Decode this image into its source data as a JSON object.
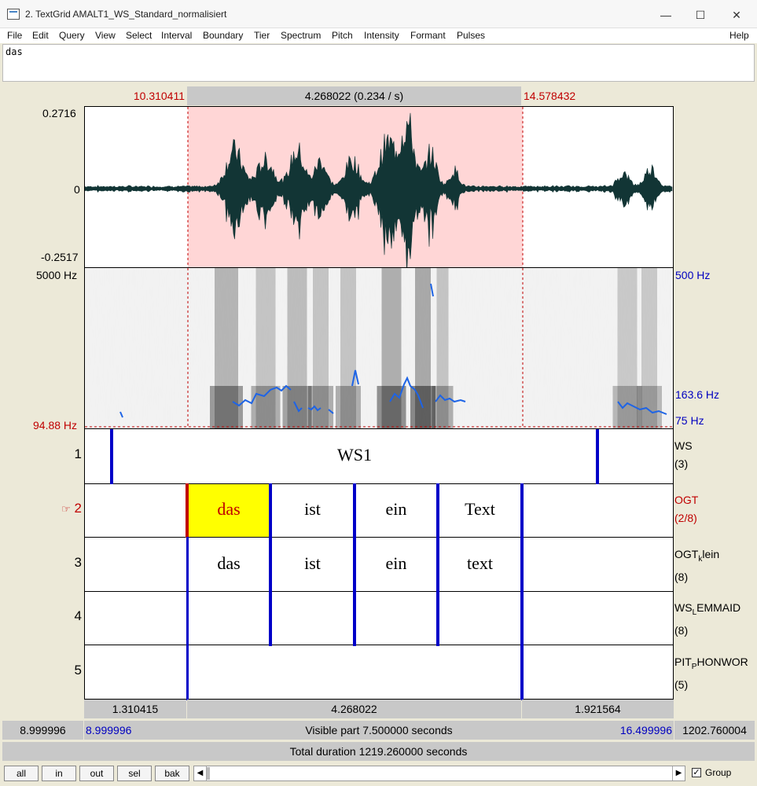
{
  "window": {
    "title": "2. TextGrid AMALT1_WS_Standard_normalisiert",
    "minimize": "—",
    "maximize": "☐",
    "close": "✕"
  },
  "menu": [
    "File",
    "Edit",
    "Query",
    "View",
    "Select",
    "Interval",
    "Boundary",
    "Tier",
    "Spectrum",
    "Pitch",
    "Intensity",
    "Formant",
    "Pulses"
  ],
  "menu_help": "Help",
  "text_field": {
    "value": "das"
  },
  "selection": {
    "start": "10.310411",
    "duration": "4.268022 (0.234 / s)",
    "end": "14.578432"
  },
  "waveform": {
    "max": "0.2716",
    "zero": "0",
    "min": "-0.2517"
  },
  "spectrogram": {
    "freq_max": "5000 Hz",
    "freq_min": "94.88 Hz",
    "pitch_max": "500 Hz",
    "pitch_cursor": "163.6 Hz",
    "pitch_min": "75 Hz"
  },
  "tiers": [
    {
      "num": "1",
      "name": "WS",
      "sub": "",
      "name2": "",
      "count": "(3)",
      "labels": [
        "WS1"
      ]
    },
    {
      "num": "2",
      "pointer": "☞",
      "name": "OGT",
      "sub": "",
      "name2": "",
      "count": "(2/8)",
      "labels": [
        "das",
        "ist",
        "ein",
        "Text"
      ]
    },
    {
      "num": "3",
      "name": "OGT",
      "sub": "k",
      "name2": "lein",
      "count": "(8)",
      "labels": [
        "das",
        "ist",
        "ein",
        "text"
      ]
    },
    {
      "num": "4",
      "name": "WS",
      "sub": "L",
      "name2": "EMMAID",
      "count": "(8)",
      "labels": []
    },
    {
      "num": "5",
      "name": "PIT",
      "sub": "P",
      "name2": "HONWOR",
      "count": "(5)",
      "labels": []
    }
  ],
  "bottom": {
    "seg_left": "1.310415",
    "seg_mid": "4.268022",
    "seg_right": "1.921564",
    "window_start": "8.999996",
    "visible_start": "8.999996",
    "visible_text": "Visible part 7.500000 seconds",
    "visible_end": "16.499996",
    "window_end": "1202.760004",
    "total": "Total duration 1219.260000 seconds"
  },
  "buttons": [
    "all",
    "in",
    "out",
    "sel",
    "bak"
  ],
  "group_label": "Group",
  "group_checked": true,
  "colors": {
    "selection": "#ffd6d6",
    "pitch": "#1e64e6",
    "boundary": "#0000c8",
    "highlight": "#ffff00",
    "red": "#c00000"
  }
}
